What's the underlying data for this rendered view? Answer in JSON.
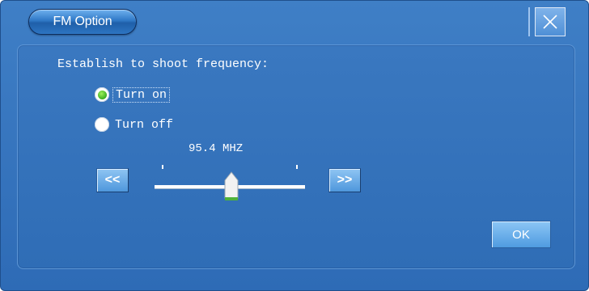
{
  "window": {
    "title": "FM Option",
    "close_icon": "close-x-icon"
  },
  "section": {
    "heading": "Establish to shoot frequency:"
  },
  "radio": {
    "options": [
      {
        "label": "Turn on",
        "selected": true
      },
      {
        "label": "Turn off",
        "selected": false
      }
    ]
  },
  "frequency": {
    "display": "95.4 MHZ",
    "slider_position": 0.51
  },
  "buttons": {
    "prev": "<<",
    "next": ">>",
    "ok": "OK"
  },
  "colors": {
    "window_bg": "#3374bd",
    "panel_bg": "#3572bb",
    "radio_selected": "#3cae21"
  }
}
